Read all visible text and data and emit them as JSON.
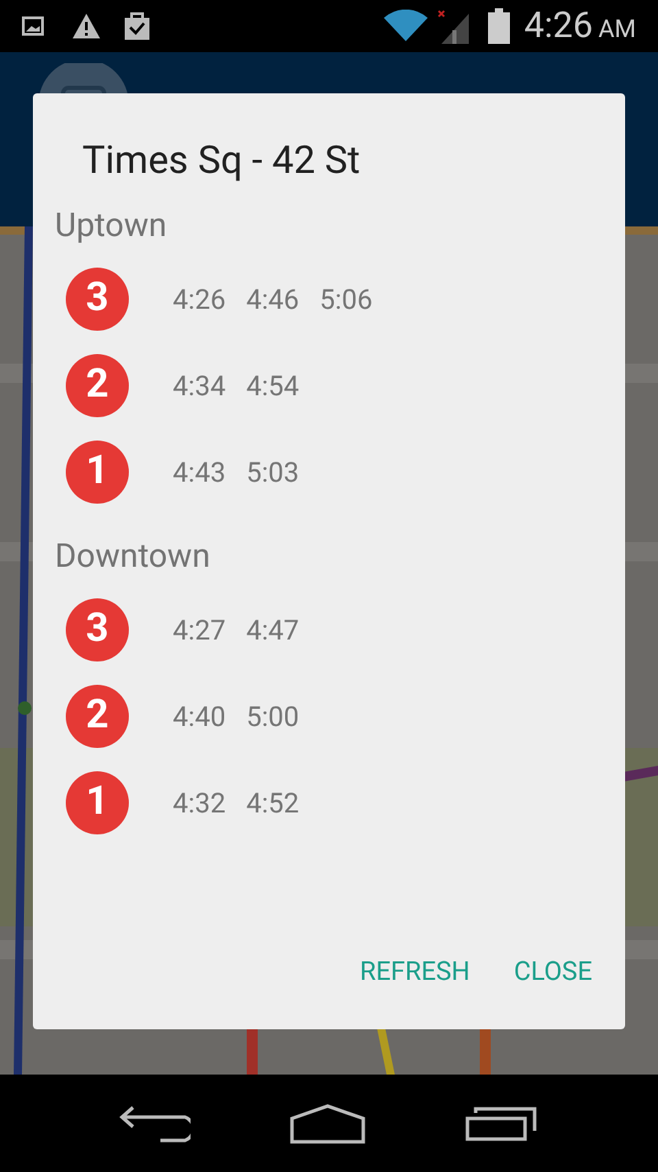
{
  "status_bar": {
    "time": "4:26",
    "meridiem": "AM"
  },
  "dialog": {
    "title": "Times Sq - 42 St",
    "sections": [
      {
        "heading": "Uptown",
        "trains": [
          {
            "line": "3",
            "times": [
              "4:26",
              "4:46",
              "5:06"
            ]
          },
          {
            "line": "2",
            "times": [
              "4:34",
              "4:54"
            ]
          },
          {
            "line": "1",
            "times": [
              "4:43",
              "5:03"
            ]
          }
        ]
      },
      {
        "heading": "Downtown",
        "trains": [
          {
            "line": "3",
            "times": [
              "4:27",
              "4:47"
            ]
          },
          {
            "line": "2",
            "times": [
              "4:40",
              "5:00"
            ]
          },
          {
            "line": "1",
            "times": [
              "4:32",
              "4:52"
            ]
          }
        ]
      }
    ],
    "buttons": [
      "REFRESH",
      "CLOSE"
    ]
  }
}
